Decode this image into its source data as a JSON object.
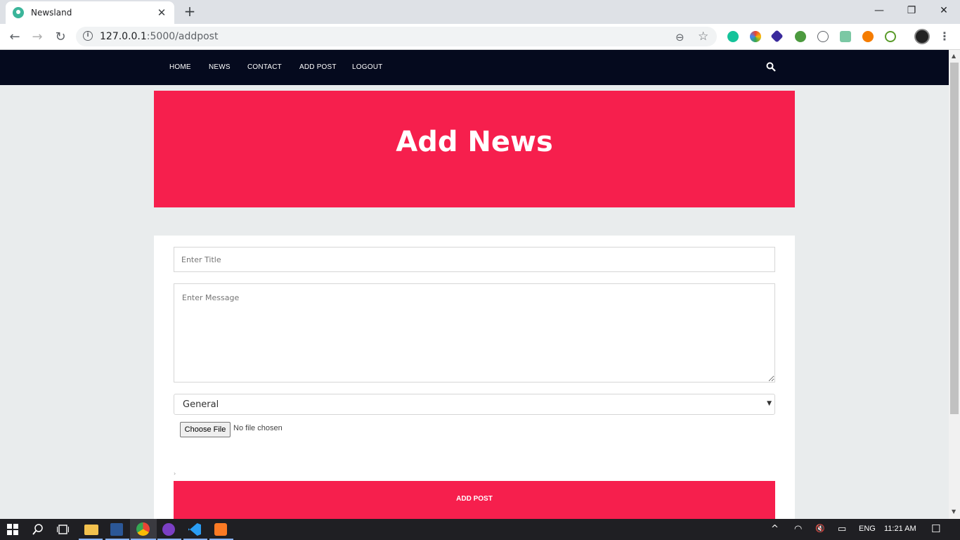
{
  "browser": {
    "tab_title": "Newsland",
    "tab_close": "✕",
    "new_tab": "+",
    "minimize": "—",
    "restore": "❐",
    "close": "✕",
    "url_host": "127.0.0.1",
    "url_path": ":5000/addpost",
    "back": "←",
    "forward": "→",
    "reload": "↻",
    "info": "i",
    "zoom": "⊖",
    "star": "☆",
    "kebab": "⋮"
  },
  "nav": {
    "items": [
      "HOME",
      "NEWS",
      "CONTACT",
      "ADD POST",
      "LOGOUT"
    ]
  },
  "hero": {
    "title": "Add News"
  },
  "form": {
    "title_placeholder": "Enter Title",
    "message_placeholder": "Enter Message",
    "category_value": "General",
    "category_caret": "▼",
    "file_button": "Choose File",
    "file_status": "No file chosen",
    "small_mark": "›",
    "submit_label": "ADD POST"
  },
  "scrollbar": {
    "up": "▲",
    "down": "▼"
  },
  "taskbar": {
    "language": "ENG",
    "time": "11:21 AM",
    "tray_up": "^",
    "wifi": "◠",
    "volume": "🔇",
    "battery": "▭",
    "notifications": "☐"
  },
  "colors": {
    "accent": "#f61f4d",
    "nav_bg": "#050a1e",
    "page_bg": "#e9eced"
  }
}
